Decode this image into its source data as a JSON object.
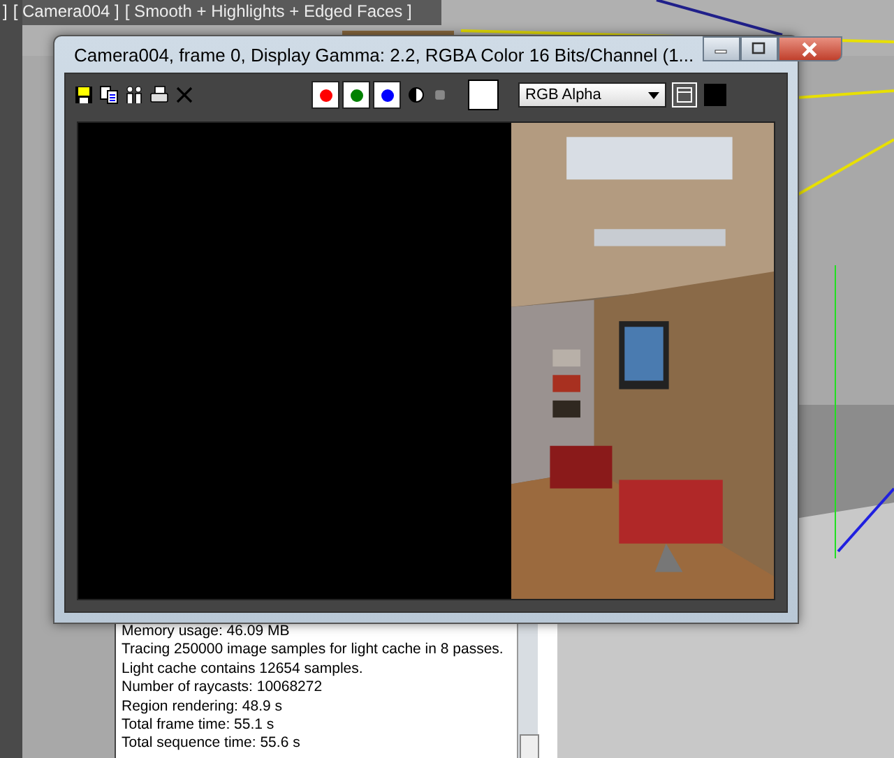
{
  "viewport": {
    "label_prefix": "]",
    "camera_label": "[ Camera004 ]",
    "shading_label": "[ Smooth + Highlights + Edged Faces ]"
  },
  "log": {
    "lines": [
      "Memory usage: 46.09 MB",
      "Tracing 250000 image samples for light cache in 8 passes.",
      "Light cache contains 12654 samples.",
      "Number of raycasts: 10068272",
      "Region rendering: 48.9 s",
      "Total frame time: 55.1 s",
      "Total sequence time: 55.6 s"
    ]
  },
  "render_window": {
    "title": "Camera004, frame 0, Display Gamma: 2.2, RGBA Color 16 Bits/Channel (1...",
    "channels": [
      {
        "color": "#ff0000"
      },
      {
        "color": "#008000"
      },
      {
        "color": "#0000ff"
      }
    ],
    "channel_select": "RGB Alpha"
  }
}
